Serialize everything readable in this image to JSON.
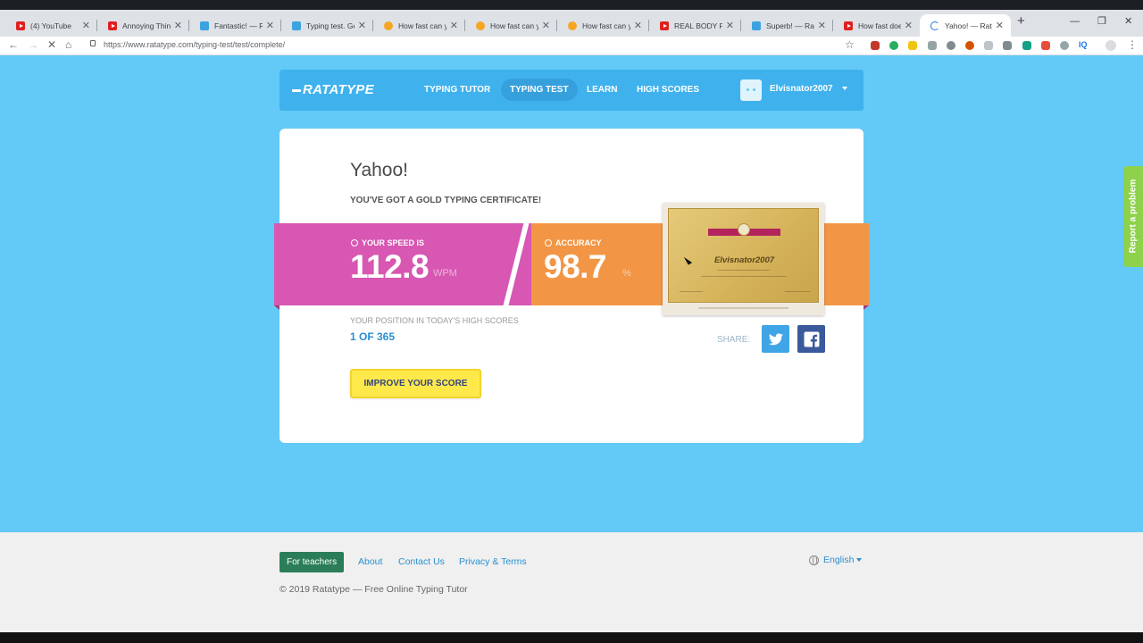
{
  "browser": {
    "tabs": [
      {
        "title": "(4) YouTube",
        "favicon": "youtube-icon"
      },
      {
        "title": "Annoying Thing",
        "favicon": "youtube-icon"
      },
      {
        "title": "Fantastic! — Rata",
        "favicon": "ratatype-icon"
      },
      {
        "title": "Typing test. Get",
        "favicon": "ratatype-icon"
      },
      {
        "title": "How fast can you",
        "favicon": "bitcoin-icon"
      },
      {
        "title": "How fast can you",
        "favicon": "bitcoin-icon"
      },
      {
        "title": "How fast can you",
        "favicon": "bitcoin-icon"
      },
      {
        "title": "REAL BODY FAT",
        "favicon": "youtube-icon"
      },
      {
        "title": "Superb! — Ratat",
        "favicon": "ratatype-icon"
      },
      {
        "title": "How fast does Bi",
        "favicon": "youtube-icon"
      },
      {
        "title": "Yahoo! — Ratatyp",
        "favicon": "loading-spinner-icon"
      }
    ],
    "active_tab_index": 10,
    "url": "https://www.ratatype.com/typing-test/test/complete/",
    "extension_label": "IQ"
  },
  "site": {
    "logo": "RATATYPE",
    "nav": [
      "TYPING TUTOR",
      "TYPING TEST",
      "LEARN",
      "HIGH SCORES"
    ],
    "active_nav": "TYPING TEST",
    "username": "Elvisnator2007"
  },
  "result": {
    "heading": "Yahoo!",
    "subheading": "YOU'VE GOT A GOLD TYPING CERTIFICATE!",
    "speed_label": "YOUR SPEED IS",
    "speed_value": "112.8",
    "speed_unit": "WPM",
    "accuracy_label": "ACCURACY",
    "accuracy_value": "98.7",
    "accuracy_unit": "%",
    "certificate_name": "Elvisnator2007",
    "position_label": "YOUR POSITION IN TODAY'S HIGH SCORES",
    "position_value": "1 OF 365",
    "share_label": "SHARE:",
    "improve_button": "IMPROVE YOUR SCORE"
  },
  "report_tab": "Report a problem",
  "footer": {
    "teachers_button": "For teachers",
    "links": [
      "About",
      "Contact Us",
      "Privacy & Terms"
    ],
    "language": "English",
    "copyright": "© 2019 Ratatype — Free Online Typing Tutor"
  },
  "colors": {
    "page_background": "#63c9f6",
    "nav_background": "#3fb2ee",
    "speed_band": "#d757b2",
    "accuracy_band": "#f29645",
    "improve_button": "#ffe94a",
    "teachers_button": "#2a7d58",
    "report_tab": "#8ed14b"
  }
}
